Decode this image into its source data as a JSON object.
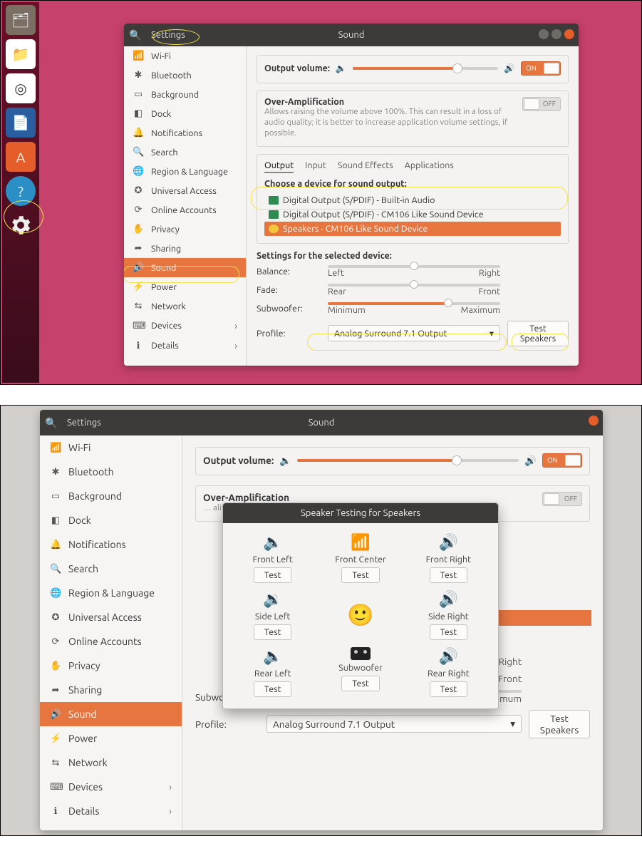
{
  "header": {
    "app": "Settings",
    "page": "Sound"
  },
  "sidebar": [
    {
      "icon": "📶",
      "label": "Wi-Fi"
    },
    {
      "icon": "✱",
      "label": "Bluetooth"
    },
    {
      "icon": "▭",
      "label": "Background"
    },
    {
      "icon": "◧",
      "label": "Dock"
    },
    {
      "icon": "🔔",
      "label": "Notifications"
    },
    {
      "icon": "🔍",
      "label": "Search"
    },
    {
      "icon": "🌐",
      "label": "Region & Language"
    },
    {
      "icon": "✪",
      "label": "Universal Access"
    },
    {
      "icon": "⟳",
      "label": "Online Accounts"
    },
    {
      "icon": "✋",
      "label": "Privacy"
    },
    {
      "icon": "➦",
      "label": "Sharing"
    },
    {
      "icon": "🔊",
      "label": "Sound",
      "active": true
    },
    {
      "icon": "⚡",
      "label": "Power"
    },
    {
      "icon": "⇆",
      "label": "Network"
    },
    {
      "icon": "⌨",
      "label": "Devices",
      "sub": true
    },
    {
      "icon": "ℹ",
      "label": "Details",
      "sub": true
    }
  ],
  "volume": {
    "label": "Output volume:",
    "pct": 72,
    "on_label": "ON"
  },
  "overamp": {
    "title": "Over-Amplification",
    "desc": "Allows raising the volume above 100%. This can result in a loss of audio quality; it is better to increase application volume settings, if possible.",
    "off_label": "OFF"
  },
  "tabs": {
    "items": [
      "Output",
      "Input",
      "Sound Effects",
      "Applications"
    ],
    "selected": 0
  },
  "devices": {
    "title": "Choose a device for sound output:",
    "list": [
      "Digital Output (S/PDIF) - Built-in Audio",
      "Digital Output (S/PDIF) - CM106 Like Sound Device",
      "Speakers - CM106 Like Sound Device"
    ],
    "selected": 2
  },
  "sel_settings": {
    "title": "Settings for the selected device:",
    "balance": {
      "label": "Balance:",
      "left": "Left",
      "right": "Right",
      "pct": 50
    },
    "fade": {
      "label": "Fade:",
      "left": "Rear",
      "right": "Front",
      "pct": 50
    },
    "subwoofer": {
      "label": "Subwoofer:",
      "left": "Minimum",
      "right": "Maximum",
      "pct": 70
    },
    "profile": {
      "label": "Profile:",
      "value": "Analog Surround 7.1 Output"
    },
    "test_btn": "Test Speakers"
  },
  "dialog": {
    "title": "Speaker Testing for Speakers",
    "test": "Test",
    "speakers": [
      "Front Left",
      "Front Center",
      "Front Right",
      "Side Left",
      "",
      "Side Right",
      "Rear Left",
      "Subwoofer",
      "Rear Right"
    ]
  }
}
